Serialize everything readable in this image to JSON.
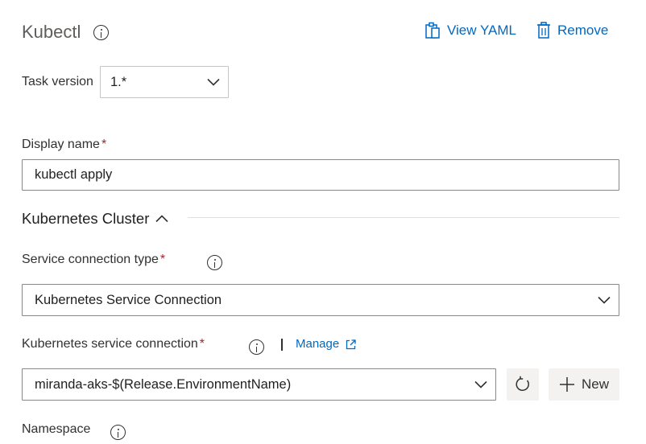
{
  "header": {
    "title": "Kubectl",
    "view_yaml_label": "View YAML",
    "remove_label": "Remove"
  },
  "task_version": {
    "label": "Task version",
    "value": "1.*"
  },
  "display_name": {
    "label": "Display name",
    "required_mark": "*",
    "value": "kubectl apply"
  },
  "section": {
    "title": "Kubernetes Cluster"
  },
  "service_connection_type": {
    "label": "Service connection type",
    "required_mark": "*",
    "value": "Kubernetes Service Connection"
  },
  "service_connection": {
    "label": "Kubernetes service connection",
    "required_mark": "*",
    "manage_label": "Manage",
    "value": "miranda-aks-$(Release.EnvironmentName)",
    "new_label": "New"
  },
  "namespace": {
    "label": "Namespace"
  },
  "colors": {
    "link": "#0069c2",
    "required": "#a4262c",
    "border": "#8a8886",
    "button_bg": "#f3f2f1"
  },
  "icons": {
    "info": "info-icon",
    "view_yaml": "clipboard-icon",
    "remove": "trash-icon",
    "dropdown": "chevron-down-icon",
    "collapse": "chevron-up-icon",
    "refresh": "refresh-icon",
    "add": "plus-icon",
    "external": "external-link-icon"
  }
}
